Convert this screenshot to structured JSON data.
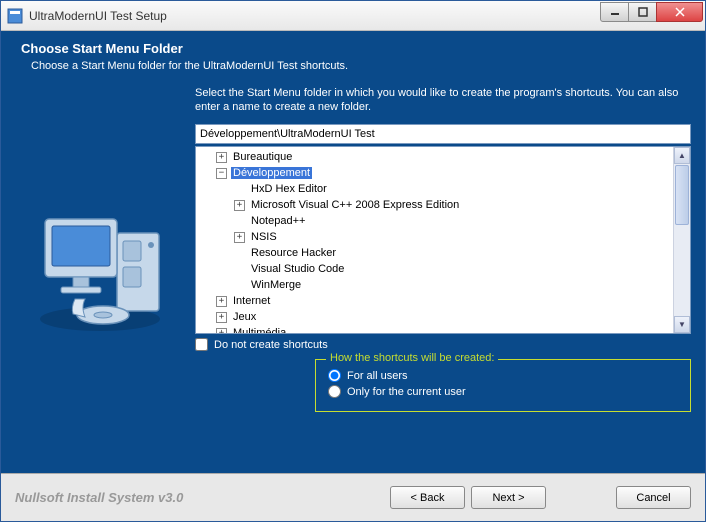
{
  "window": {
    "title": "UltraModernUI Test Setup"
  },
  "header": {
    "title": "Choose Start Menu Folder",
    "subtitle": "Choose a Start Menu folder for the UltraModernUI Test shortcuts."
  },
  "instruction": "Select the Start Menu folder in which you would like to create the program's shortcuts. You can also enter a name to create a new folder.",
  "path_value": "Développement\\UltraModernUI Test",
  "tree": [
    {
      "label": "Bureautique",
      "depth": 0,
      "exp": "plus",
      "sel": false
    },
    {
      "label": "Développement",
      "depth": 0,
      "exp": "minus",
      "sel": true
    },
    {
      "label": "HxD Hex Editor",
      "depth": 1,
      "exp": "none",
      "sel": false
    },
    {
      "label": "Microsoft Visual C++ 2008 Express Edition",
      "depth": 1,
      "exp": "plus",
      "sel": false
    },
    {
      "label": "Notepad++",
      "depth": 1,
      "exp": "none",
      "sel": false
    },
    {
      "label": "NSIS",
      "depth": 1,
      "exp": "plus",
      "sel": false
    },
    {
      "label": "Resource Hacker",
      "depth": 1,
      "exp": "none",
      "sel": false
    },
    {
      "label": "Visual Studio Code",
      "depth": 1,
      "exp": "none",
      "sel": false
    },
    {
      "label": "WinMerge",
      "depth": 1,
      "exp": "none",
      "sel": false
    },
    {
      "label": "Internet",
      "depth": 0,
      "exp": "plus",
      "sel": false
    },
    {
      "label": "Jeux",
      "depth": 0,
      "exp": "plus",
      "sel": false
    },
    {
      "label": "Multimédia",
      "depth": 0,
      "exp": "plus",
      "sel": false
    }
  ],
  "checkbox_label": "Do not create shortcuts",
  "checkbox_checked": false,
  "group": {
    "legend": "How the shortcuts will be created:",
    "opt_all": "For all users",
    "opt_current": "Only for the current user",
    "selected": "all"
  },
  "footer": {
    "brand": "Nullsoft Install System v3.0",
    "back": "< Back",
    "next": "Next >",
    "cancel": "Cancel"
  }
}
